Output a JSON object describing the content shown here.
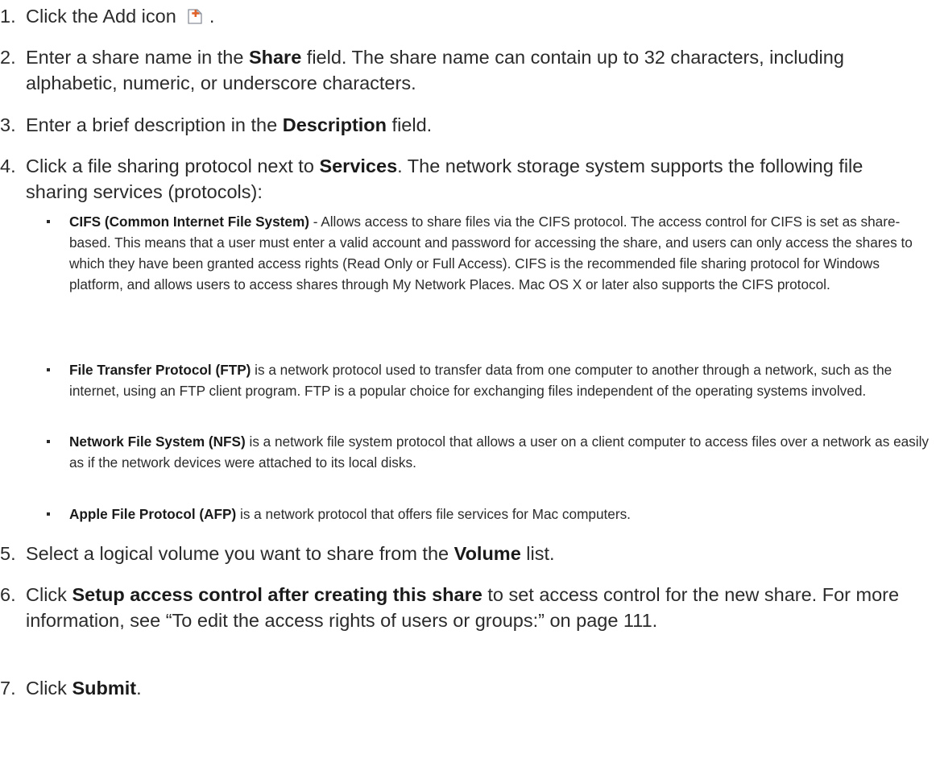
{
  "steps": [
    {
      "num": "1.",
      "pre": "Click the Add icon",
      "post": "."
    },
    {
      "num": "2.",
      "pre": "Enter a share name in the ",
      "bold": "Share",
      "post": " field. The share name can contain up to 32 characters, including alphabetic, numeric, or underscore characters."
    },
    {
      "num": "3.",
      "pre": "Enter a brief description in the ",
      "bold": "Description",
      "post": " field."
    },
    {
      "num": "4.",
      "pre": "Click a file sharing protocol next to ",
      "bold": "Services",
      "post": ". The network storage system supports the following file sharing services (protocols):"
    },
    {
      "num": "5.",
      "pre": "Select a logical volume you want to share from the ",
      "bold": "Volume",
      "post": " list."
    },
    {
      "num": "6.",
      "pre": "Click ",
      "bold": "Setup access control after creating this share",
      "post": " to set access control for the new share. For more information, see “To edit the access rights of users or groups:” on page 111."
    },
    {
      "num": "7.",
      "pre": "Click ",
      "bold": "Submit",
      "post": "."
    }
  ],
  "bullets": [
    {
      "bold": "CIFS (Common Internet File System)",
      "text": " - Allows access to share files via the CIFS protocol. The access control for CIFS is set as share-based. This means that a user must enter a valid account and password for accessing the share, and users can only access the shares to which they have been granted access rights (Read Only or Full Access). CIFS is the recommended file sharing protocol for Windows platform, and allows users to access shares through My Network Places. Mac OS X or later also supports the CIFS protocol."
    },
    {
      "bold": "File Transfer Protocol (FTP)",
      "text": " is a network protocol used to transfer data from one computer to another through a network, such as the internet, using an FTP client program. FTP is a popular choice for exchanging files independent of the operating systems involved."
    },
    {
      "bold": "Network File System (NFS)",
      "text": " is a network file system protocol that allows a user on a client computer to access files over a network as easily as if the network devices were attached to its local disks."
    },
    {
      "bold": "Apple File Protocol (AFP)",
      "text": " is a network protocol that offers file services for Mac computers."
    }
  ],
  "icons": {
    "add": "add-document-icon"
  },
  "colors": {
    "text": "#2b2b2b",
    "icon_accent": "#e0632a"
  }
}
